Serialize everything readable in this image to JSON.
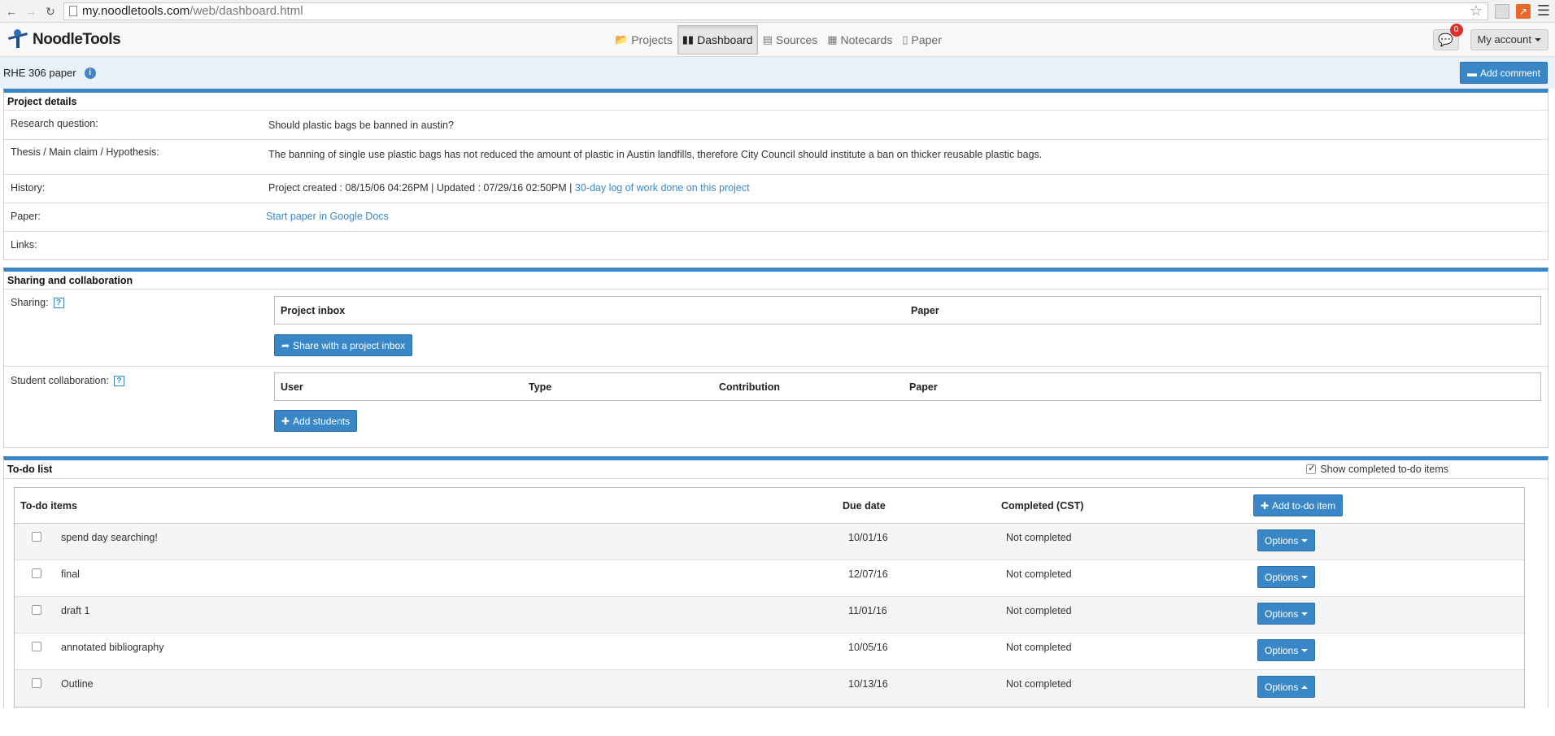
{
  "browser": {
    "url_host": "my.noodletools.com",
    "url_path": "/web/dashboard.html"
  },
  "app": {
    "logo_text": "NoodleTools",
    "tabs": [
      {
        "label": "Projects",
        "icon": "folder-open-icon"
      },
      {
        "label": "Dashboard",
        "icon": "bar-chart-icon"
      },
      {
        "label": "Sources",
        "icon": "list-icon"
      },
      {
        "label": "Notecards",
        "icon": "grid-icon"
      },
      {
        "label": "Paper",
        "icon": "document-icon"
      }
    ],
    "messages_count": "0",
    "account_label": "My account"
  },
  "project": {
    "title": "RHE 306 paper",
    "add_comment_label": "Add comment"
  },
  "details": {
    "heading": "Project details",
    "research_label": "Research question:",
    "research_value": "Should plastic bags be banned in austin?",
    "thesis_label": "Thesis / Main claim / Hypothesis:",
    "thesis_value": "The banning of single use plastic bags has not reduced the amount of plastic in Austin landfills, therefore City Council should institute a ban on  thicker reusable plastic bags.",
    "history_label": "History:",
    "history_value": "Project created : 08/15/06 04:26PM | Updated : 07/29/16 02:50PM | ",
    "history_link": "30-day log of work done on this project",
    "paper_label": "Paper:",
    "paper_link": "Start paper in Google Docs",
    "links_label": "Links:"
  },
  "sharing": {
    "heading": "Sharing and collaboration",
    "sharing_label": "Sharing:",
    "inbox_col1": "Project inbox",
    "inbox_col2": "Paper",
    "share_button": "Share with a project inbox",
    "collab_label": "Student collaboration:",
    "collab_cols": [
      "User",
      "Type",
      "Contribution",
      "Paper"
    ],
    "add_students_button": "Add students"
  },
  "todo": {
    "heading": "To-do list",
    "show_completed_label": "Show completed to-do items",
    "columns": [
      "To-do items",
      "Due date",
      "Completed (CST)"
    ],
    "add_item_button": "Add to-do item",
    "options_label": "Options",
    "items": [
      {
        "title": "spend day searching!",
        "due": "10/01/16",
        "completed": "Not completed"
      },
      {
        "title": "final",
        "due": "12/07/16",
        "completed": "Not completed"
      },
      {
        "title": "draft 1",
        "due": "11/01/16",
        "completed": "Not completed"
      },
      {
        "title": "annotated bibliography",
        "due": "10/05/16",
        "completed": "Not completed"
      },
      {
        "title": "Outline",
        "due": "10/13/16",
        "completed": "Not completed"
      }
    ]
  },
  "colors": {
    "accent": "#3a87c8",
    "titlebar_bg": "#e8f0f8",
    "badge": "#e0302a"
  }
}
